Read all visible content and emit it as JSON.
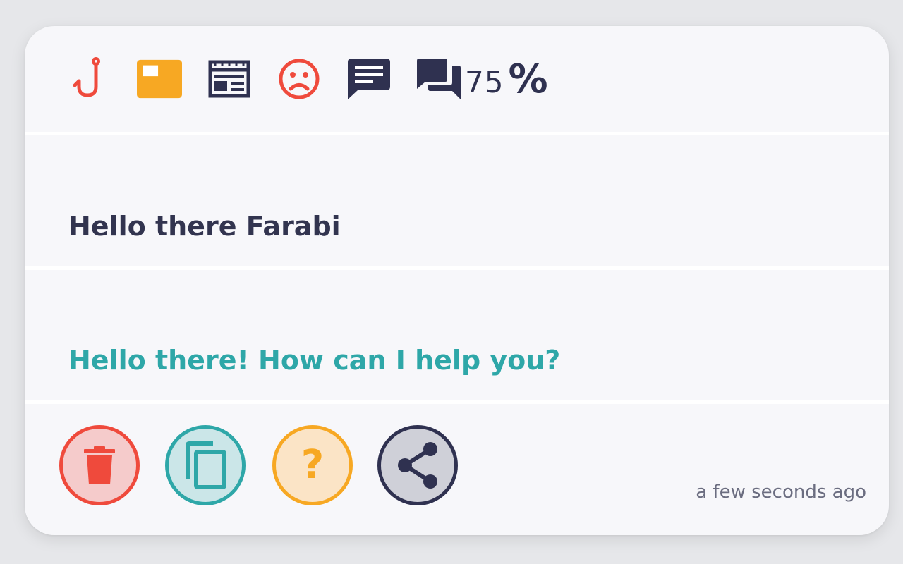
{
  "toolbar": {
    "icons": [
      "hook-icon",
      "label-icon",
      "newspaper-icon",
      "sad-face-icon",
      "message-icon",
      "forum-icon"
    ],
    "percent_value": "75",
    "percent_sign": "%"
  },
  "messages": {
    "user_text": "Hello there Farabi",
    "bot_text": "Hello there! How can I help you?"
  },
  "footer": {
    "help_glyph": "?",
    "timestamp": "a few seconds ago"
  },
  "colors": {
    "red": "#ef4a3c",
    "orange": "#f7a823",
    "navy": "#2f3150",
    "teal": "#2ea7a8",
    "card_bg": "#f7f7fa"
  }
}
